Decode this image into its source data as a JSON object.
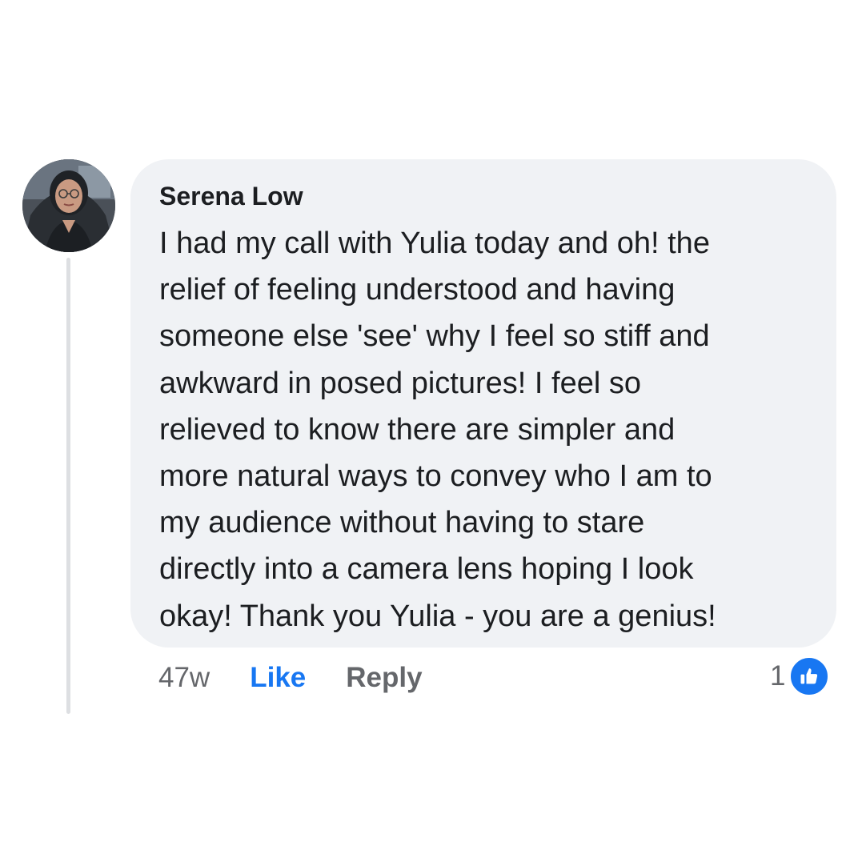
{
  "comment": {
    "author": "Serena Low",
    "text_lines": [
      "I had my call with Yulia today and oh! the",
      "relief of feeling understood and having",
      "someone else 'see' why I feel so stiff and",
      "awkward in posed pictures! I feel so",
      "relieved to know there are simpler and",
      "more natural ways to convey who I am to",
      "my audience without having to stare",
      "directly into a camera lens hoping I look",
      "okay! Thank you Yulia - you are a genius!"
    ],
    "timestamp": "47w",
    "like_label": "Like",
    "reply_label": "Reply",
    "reaction_count": "1",
    "reaction_icon": "thumbs-up-icon",
    "avatar_icon": "profile-photo"
  },
  "colors": {
    "bubble": "#f0f2f5",
    "like_blue": "#1877f2",
    "meta_gray": "#65676b",
    "text": "#1c1e21",
    "thread_line": "#dddfe2"
  }
}
